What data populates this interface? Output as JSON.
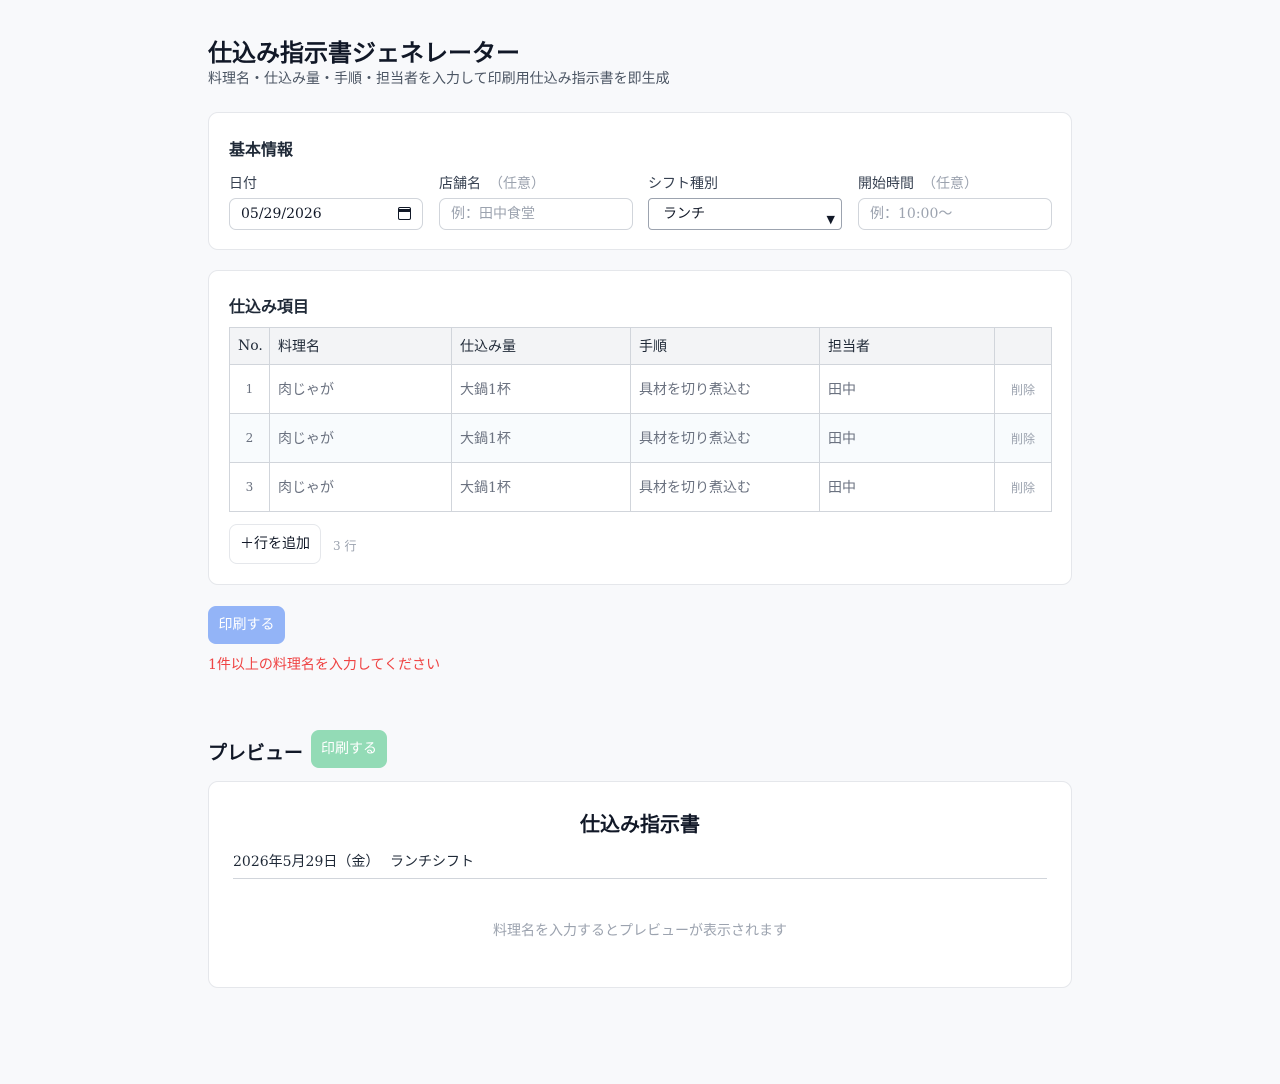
{
  "header": {
    "title": "仕込み指示書ジェネレーター",
    "subtitle": "料理名・仕込み量・手順・担当者を入力して印刷用仕込み指示書を即生成"
  },
  "basic_info": {
    "section_title": "基本情報",
    "date": {
      "label": "日付",
      "value": "05/29/2026"
    },
    "store": {
      "label": "店舗名",
      "optional": "（任意）",
      "placeholder": "例：田中食堂"
    },
    "shift": {
      "label": "シフト種別",
      "value": "ランチ"
    },
    "start_time": {
      "label": "開始時間",
      "optional": "（任意）",
      "placeholder": "例：10:00〜"
    }
  },
  "items": {
    "section_title": "仕込み項目",
    "columns": [
      "No.",
      "料理名",
      "仕込み量",
      "手順",
      "担当者",
      ""
    ],
    "rows": [
      {
        "no": "1",
        "dish": "肉じゃが",
        "amount": "大鍋1杯",
        "steps": "具材を切り煮込む",
        "staff": "田中",
        "delete": "削除"
      },
      {
        "no": "2",
        "dish": "肉じゃが",
        "amount": "大鍋1杯",
        "steps": "具材を切り煮込む",
        "staff": "田中",
        "delete": "削除"
      },
      {
        "no": "3",
        "dish": "肉じゃが",
        "amount": "大鍋1杯",
        "steps": "具材を切り煮込む",
        "staff": "田中",
        "delete": "削除"
      }
    ],
    "add_button": "＋行を追加",
    "row_count": "3 行"
  },
  "actions": {
    "print_label": "印刷する",
    "error": "1件以上の料理名を入力してください"
  },
  "preview": {
    "title": "プレビュー",
    "print_label": "印刷する",
    "doc_title": "仕込み指示書",
    "date": "2026年5月29日（金）",
    "shift": "ランチシフト",
    "empty_message": "料理名を入力するとプレビューが表示されます"
  },
  "colors": {
    "print_button": "#93b4f7",
    "preview_print_button": "#93dbb6",
    "error": "#ef4444"
  }
}
